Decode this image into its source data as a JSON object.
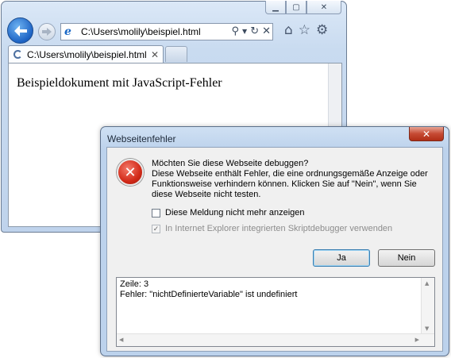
{
  "browser": {
    "address": "C:\\Users\\molily\\beispiel.html",
    "tab_title": "C:\\Users\\molily\\beispiel.html",
    "document_text": "Beispieldokument mit JavaScript-Fehler",
    "icons": [
      "back-arrow-icon",
      "forward-arrow-icon",
      "ie-logo-icon",
      "search-icon",
      "refresh-icon",
      "stop-icon",
      "home-icon",
      "favorites-star-icon",
      "tools-gear-icon"
    ]
  },
  "dialog": {
    "title": "Webseitenfehler",
    "question": "Möchten Sie diese Webseite debuggen?",
    "message": "Diese Webseite enthält Fehler, die eine ordnungsgemäße Anzeige oder Funktionsweise verhindern können. Klicken Sie auf \"Nein\", wenn Sie diese Webseite nicht testen.",
    "checkbox_dont_show": "Diese Meldung nicht mehr anzeigen",
    "checkbox_debugger": "In Internet Explorer integrierten Skriptdebugger verwenden",
    "yes_label": "Ja",
    "no_label": "Nein",
    "details_line1": "Zeile: 3",
    "details_line2": "Fehler: \"nichtDefinierteVariable\" ist undefiniert",
    "colors": {
      "error_red": "#d22a19",
      "title_bar": "#cfe0f3"
    }
  }
}
